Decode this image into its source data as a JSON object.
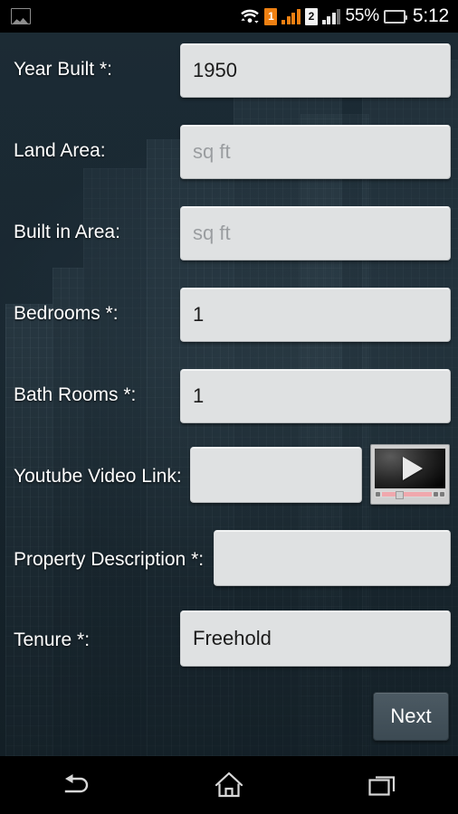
{
  "status_bar": {
    "gallery_icon": "gallery-icon",
    "wifi_icon": "wifi-icon",
    "sim1_label": "1",
    "sim2_label": "2",
    "signal1_icon": "signal-bars-icon",
    "signal2_icon": "signal-bars-icon",
    "battery_percent": "55%",
    "battery_icon": "battery-icon",
    "time": "5:12"
  },
  "form": {
    "fields": [
      {
        "label": "Year Built *:",
        "value": "1950",
        "placeholder": ""
      },
      {
        "label": "Land Area:",
        "value": "",
        "placeholder": "sq ft"
      },
      {
        "label": "Built in Area:",
        "value": "",
        "placeholder": "sq ft"
      },
      {
        "label": "Bedrooms *:",
        "value": "1",
        "placeholder": ""
      },
      {
        "label": "Bath Rooms *:",
        "value": "1",
        "placeholder": ""
      },
      {
        "label": "Youtube Video Link:",
        "value": "",
        "placeholder": ""
      },
      {
        "label": "Property Description *:",
        "value": "",
        "placeholder": ""
      },
      {
        "label": "Tenure *:",
        "value": "Freehold",
        "placeholder": ""
      }
    ],
    "video_thumbnail_icon": "video-play-thumbnail-icon",
    "next_label": "Next"
  },
  "nav_bar": {
    "back_icon": "back-icon",
    "home_icon": "home-icon",
    "recents_icon": "recents-icon"
  },
  "colors": {
    "background": "#1c2b33",
    "field_background": "#dfe1e2",
    "label_text": "#ffffff",
    "placeholder_text": "#9a9da0",
    "sim1_accent": "#ee8012",
    "battery_green": "#7ac043",
    "next_button": "#44525b"
  }
}
